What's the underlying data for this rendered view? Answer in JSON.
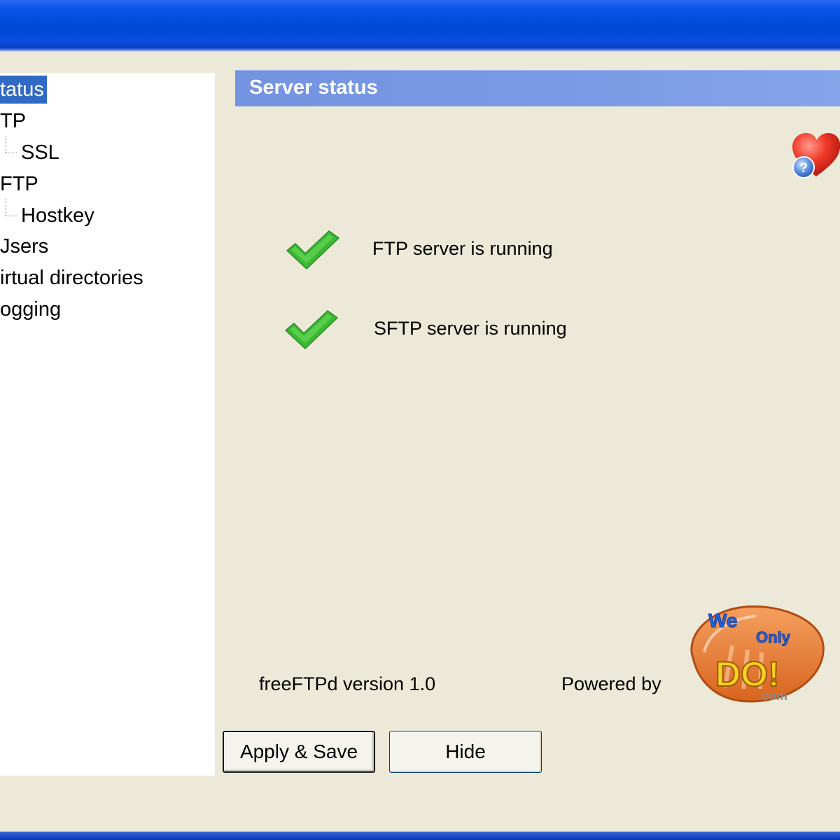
{
  "tree": {
    "items": [
      {
        "label": "tatus",
        "selected": true
      },
      {
        "label": "TP"
      },
      {
        "label": "SSL"
      },
      {
        "label": "FTP"
      },
      {
        "label": "Hostkey"
      },
      {
        "label": "Jsers"
      },
      {
        "label": "irtual directories"
      },
      {
        "label": "ogging"
      }
    ]
  },
  "panel": {
    "title": "Server status",
    "statuses": [
      {
        "text": "FTP server is running",
        "icon": "check-icon"
      },
      {
        "text": "SFTP server is running",
        "icon": "check-icon"
      }
    ],
    "version": "freeFTPd version 1.0",
    "powered_by": "Powered by",
    "logo": {
      "line1": "We",
      "line2": "Only",
      "line3": "DO!",
      "line4": "com"
    }
  },
  "buttons": {
    "apply_save": "Apply & Save",
    "hide": "Hide"
  },
  "colors": {
    "titlebar": "#0047d6",
    "selection": "#316ac5",
    "header": "#7b9be6",
    "check": "#3cb833",
    "window": "#ece9d8"
  }
}
